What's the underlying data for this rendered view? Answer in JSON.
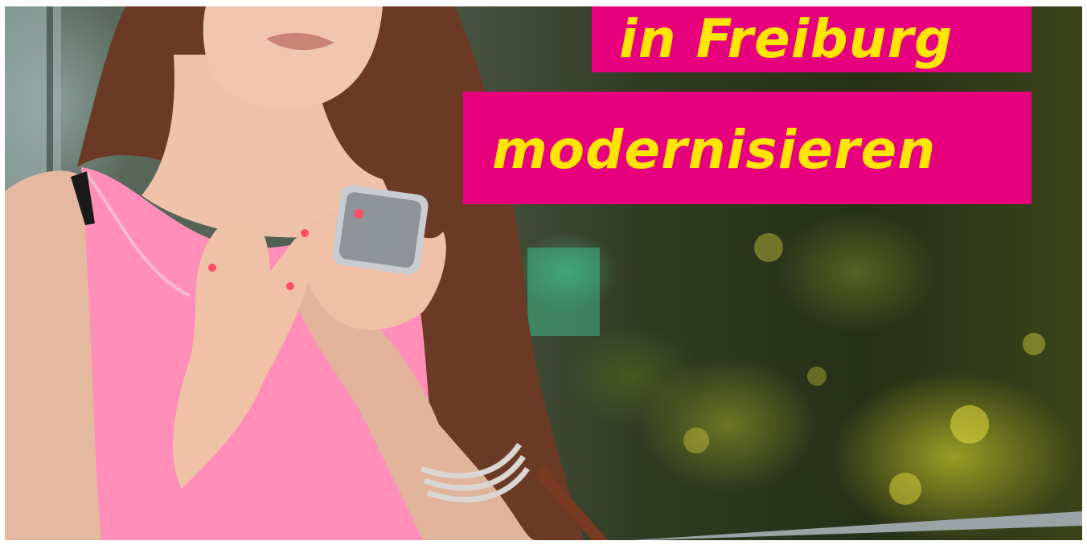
{
  "image": {
    "subject": "woman-with-smartphone",
    "colors": {
      "headline_background": "#e6007e",
      "headline_text": "#ffe500",
      "top_color": "#ff8fb8"
    }
  },
  "headline": {
    "line1": "in Freiburg",
    "line2": "modernisieren"
  }
}
